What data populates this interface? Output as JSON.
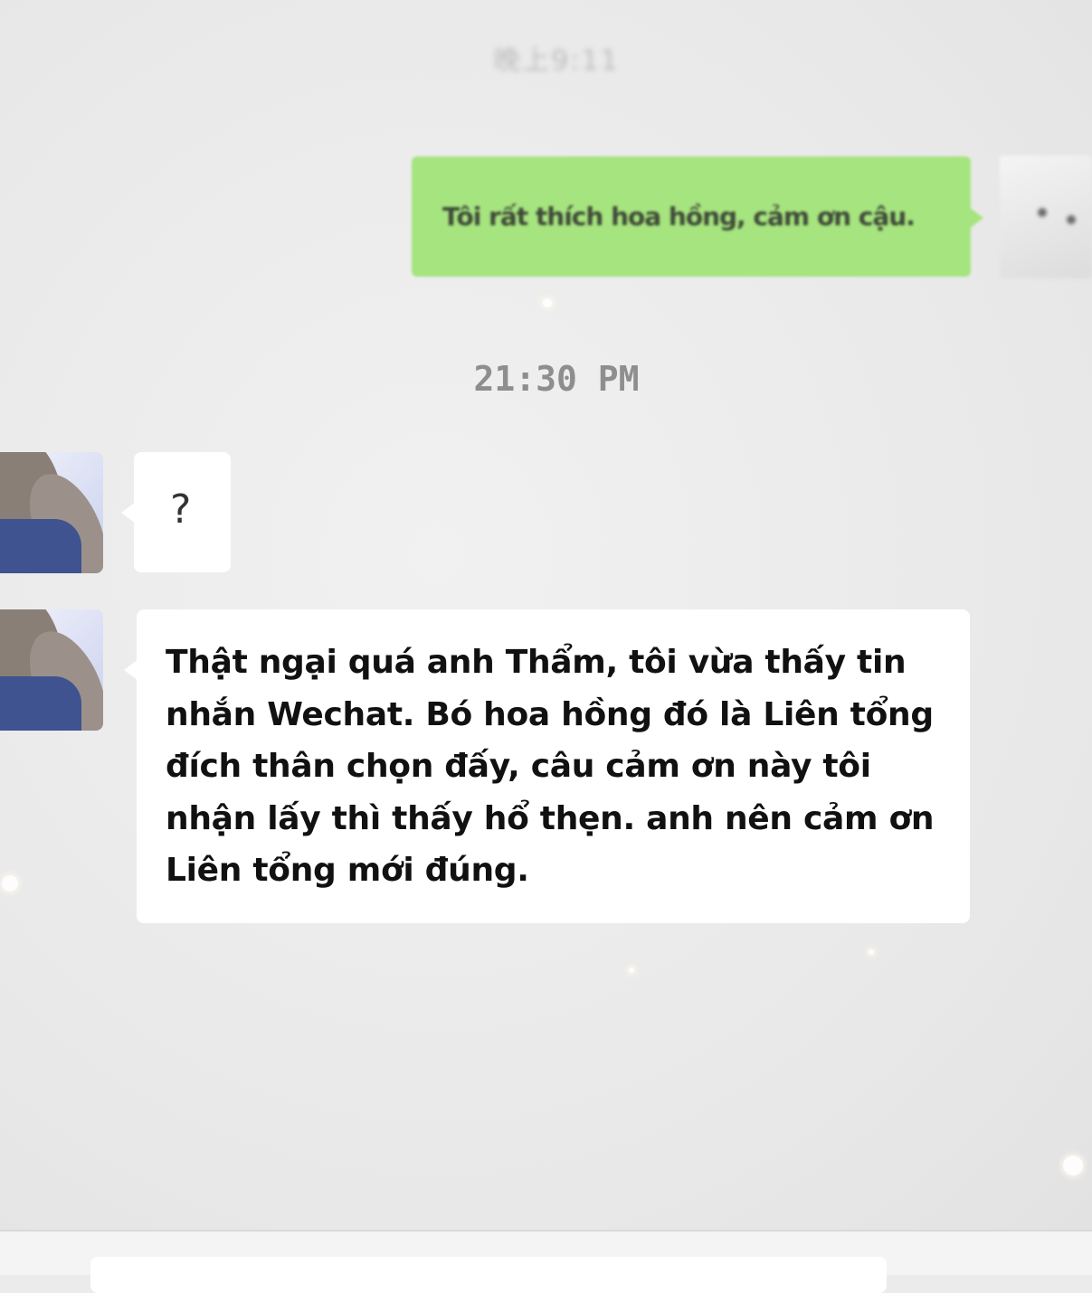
{
  "chat": {
    "top_timestamp": "晚上9:11",
    "sent_message": "Tôi rất thích hoa hồng, cảm ơn cậu.",
    "mid_timestamp": "21:30 PM",
    "received_messages": [
      "?",
      "Thật ngại quá anh Thẩm, tôi vừa thấy tin nhắn Wechat. Bó hoa hồng đó là Liên tổng đích thân chọn đấy, câu cảm ơn này tôi nhận lấy thì thấy hổ thẹn. anh nên cảm ơn Liên tổng mới đúng."
    ]
  },
  "icons": {
    "self_avatar": "cat-avatar-icon",
    "contact_avatar": "girl-avatar-icon"
  },
  "colors": {
    "sent_bubble": "#a6e47f",
    "received_bubble": "#ffffff",
    "background": "#ebebeb"
  }
}
